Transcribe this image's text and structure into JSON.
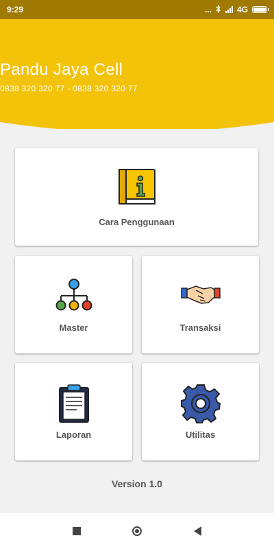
{
  "status_bar": {
    "time": "9:29",
    "dots": "...",
    "network": "4G"
  },
  "header": {
    "title": "Pandu Jaya Cell",
    "phone": "0838 320 320 77 - 0838 320 320 77",
    "color": "#f3c30a"
  },
  "menu": {
    "cara": {
      "label": "Cara Penggunaan",
      "icon": "info-book-icon"
    },
    "master": {
      "label": "Master",
      "icon": "hierarchy-icon"
    },
    "transaksi": {
      "label": "Transaksi",
      "icon": "handshake-icon"
    },
    "laporan": {
      "label": "Laporan",
      "icon": "clipboard-icon"
    },
    "utilitas": {
      "label": "Utilitas",
      "icon": "gear-icon"
    }
  },
  "version": "Version 1.0",
  "nav": {
    "recents": "square-icon",
    "home": "circle-icon",
    "back": "triangle-back-icon"
  }
}
